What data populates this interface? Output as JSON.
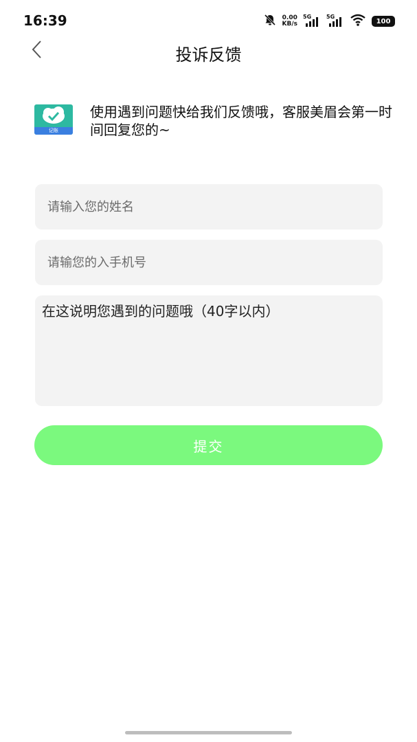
{
  "status_bar": {
    "time": "16:39",
    "net_speed_value": "0.00",
    "net_speed_unit": "KB/s",
    "signal_1_label": "5G",
    "signal_2_label": "5G",
    "battery": "100"
  },
  "header": {
    "title": "投诉反馈",
    "back_icon": "chevron-left-icon"
  },
  "intro": {
    "text": "使用遇到问题快给我们反馈哦，客服美眉会第一时间回复您的~",
    "logo_label": "记账"
  },
  "form": {
    "name_placeholder": "请输入您的姓名",
    "phone_placeholder": "请输您的入手机号",
    "problem_placeholder": "在这说明您遇到的问题哦（40字以内）",
    "submit_label": "提交"
  },
  "colors": {
    "submit_bg": "#7bf97e",
    "field_bg": "#f3f3f3",
    "logo_bg": "#2db9a1"
  }
}
